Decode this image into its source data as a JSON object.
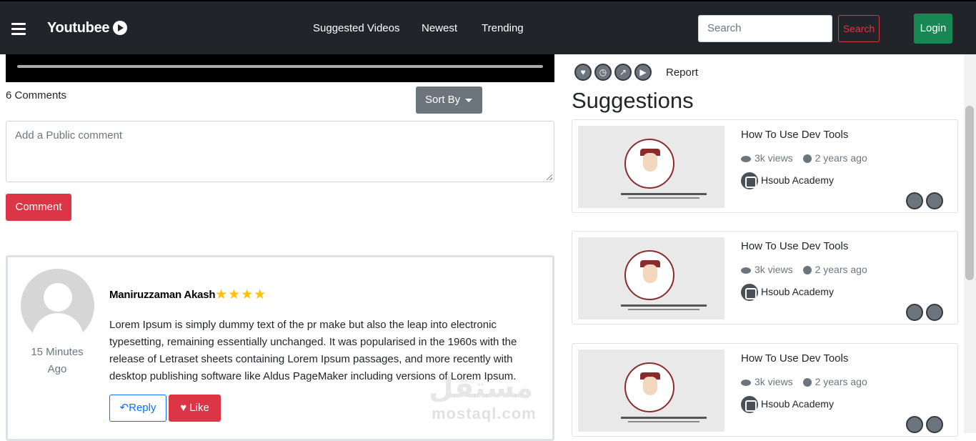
{
  "navbar": {
    "brand": "Youtubee",
    "links": [
      "Suggested Videos",
      "Newest",
      "Trending"
    ],
    "search_placeholder": "Search",
    "search_button": "Search",
    "login_button": "Login"
  },
  "comments": {
    "count_label": "6 Comments",
    "sort_label": "Sort By",
    "input_placeholder": "Add a Public comment",
    "submit_label": "Comment",
    "items": [
      {
        "author": "Maniruzzaman Akash",
        "stars": "★★★★",
        "time_ago": "15 Minutes Ago",
        "text": "Lorem Ipsum is simply dummy text of the pr make but also the leap into electronic typesetting, remaining essentially unchanged. It was popularised in the 1960s with the release of Letraset sheets containing Lorem Ipsum passages, and more recently with desktop publishing software like Aldus PageMaker including versions of Lorem Ipsum.",
        "reply_label": "Reply",
        "like_label": "Like"
      }
    ]
  },
  "actions": {
    "icons": [
      "heart-icon",
      "clock-icon",
      "share-icon",
      "play-icon"
    ],
    "report_label": "Report"
  },
  "suggestions": {
    "title": "Suggestions",
    "items": [
      {
        "title": "How To Use Dev Tools",
        "views": "3k views",
        "age": "2 years ago",
        "channel": "Hsoub Academy"
      },
      {
        "title": "How To Use Dev Tools",
        "views": "3k views",
        "age": "2 years ago",
        "channel": "Hsoub Academy"
      },
      {
        "title": "How To Use Dev Tools",
        "views": "3k views",
        "age": "2 years ago",
        "channel": "Hsoub Academy"
      }
    ]
  },
  "watermark": {
    "arabic": "مستقل",
    "latin": "mostaql.com"
  }
}
